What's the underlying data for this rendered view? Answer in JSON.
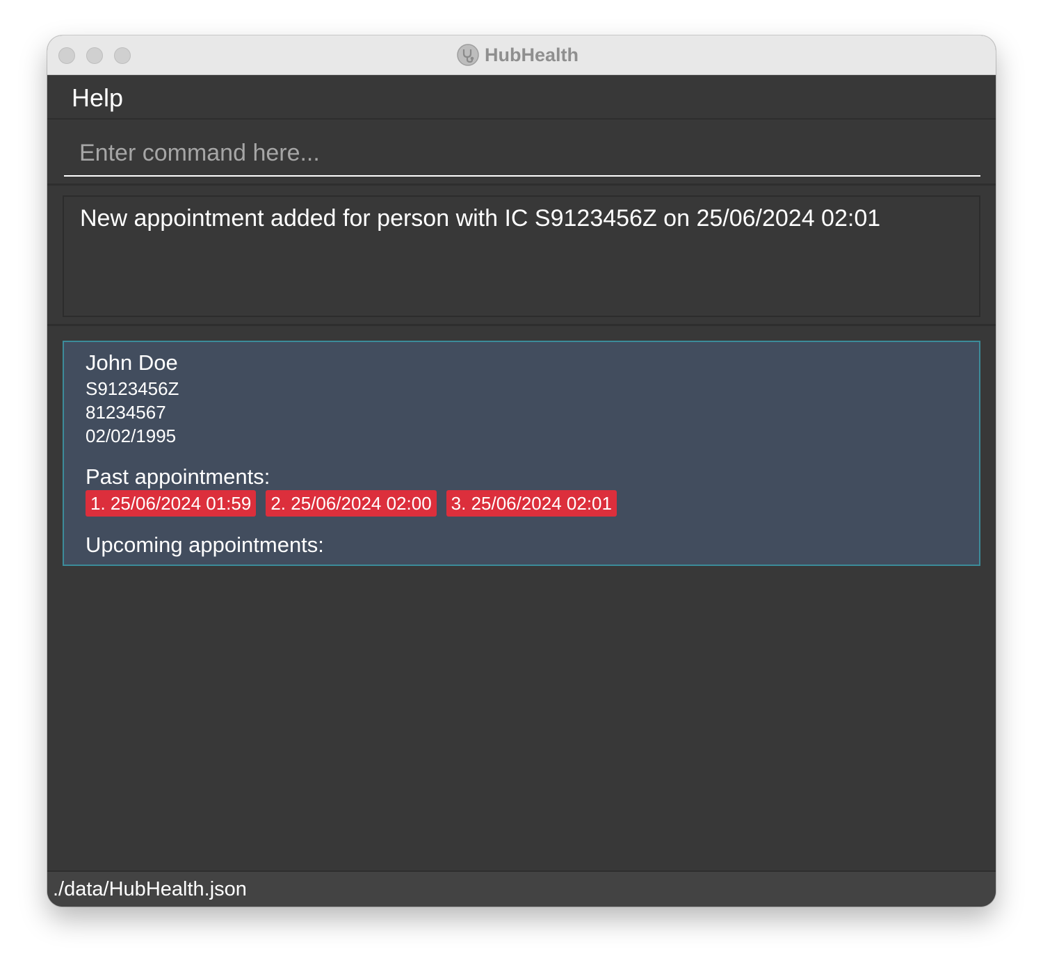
{
  "window": {
    "title": "HubHealth",
    "app_icon": "stethoscope-icon"
  },
  "menu": {
    "help_label": "Help"
  },
  "command": {
    "placeholder": "Enter command here...",
    "value": ""
  },
  "result": {
    "message": "New appointment added for person with IC S9123456Z on 25/06/2024 02:01"
  },
  "persons": [
    {
      "name": "John Doe",
      "ic": "S9123456Z",
      "phone": "81234567",
      "dob": "02/02/1995",
      "past_heading": "Past appointments:",
      "past_appointments": [
        "1. 25/06/2024 01:59",
        "2. 25/06/2024 02:00",
        "3. 25/06/2024 02:01"
      ],
      "upcoming_heading": "Upcoming appointments:",
      "upcoming_appointments": []
    }
  ],
  "status": {
    "path": "./data/HubHealth.json"
  },
  "colors": {
    "background": "#383838",
    "card_background": "#424d5e",
    "card_border": "#3c8c9a",
    "tag_background": "#dc2f3c",
    "status_bar": "#434343"
  }
}
